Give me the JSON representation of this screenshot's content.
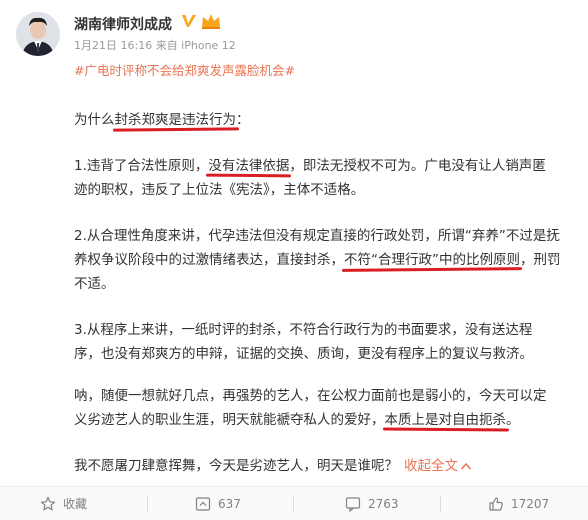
{
  "post": {
    "author": "湖南律师刘成成",
    "meta": "1月21日 16:16 来自 iPhone 12",
    "topic": "#广电时评称不会给郑爽发声露脸机会#",
    "p0": {
      "a": "为什么",
      "b": "封杀郑爽是违法行为",
      "c": "："
    },
    "p1": {
      "a": "1.违背了合法性原则，",
      "b": "没有法律依据",
      "c": "，即法无授权不可为。广电没有让人销声匿",
      "line2": "迹的职权，违反了上位法《宪法》，主体不适格。"
    },
    "p2": {
      "line1": "2.从合理性角度来讲，代孕违法但没有规定直接的行政处罚，所谓“弃养”不过是抚",
      "a": "养权争议阶段中的过激情绪表达，直接封杀，",
      "b": "不符“合理行政”中的比例原则",
      "c": "，刑罚",
      "line3": "不适。"
    },
    "p3": {
      "line1": "3.从程序上来讲，一纸时评的封杀，不符合行政行为的书面要求，没有送达程",
      "line2": "序，也没有郑爽方的申辩，证据的交换、质询，更没有程序上的复议与救济。"
    },
    "p4": {
      "line1": "呐，随便一想就好几点，再强势的艺人，在公权力面前也是弱小的，今天可以定",
      "a": "义劣迹艺人的职业生涯，明天就能褫夺私人的爱好，",
      "b": "本质上是对自由扼杀",
      "c": "。"
    },
    "p5": {
      "text": "我不愿屠刀肆意挥舞，今天是劣迹艺人，明天是谁呢？",
      "collapse": "收起全文"
    }
  },
  "toolbar": {
    "favorite_label": "收藏",
    "repost_count": "637",
    "comment_count": "2763",
    "like_count": "17207"
  },
  "icons": [
    "verified-v-icon",
    "member-crown-icon",
    "star-icon",
    "repost-icon",
    "comment-icon",
    "like-icon",
    "chevron-up-icon"
  ],
  "colors": {
    "accent": "#eb7350",
    "underline": "#d81e24",
    "text": "#333333",
    "muted": "#808080"
  }
}
